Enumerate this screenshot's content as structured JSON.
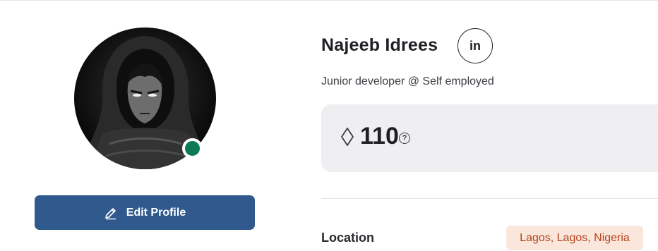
{
  "profile": {
    "name": "Najeeb Idrees",
    "headline": "Junior developer @ Self employed",
    "online_status_color": "#0b7a55",
    "linkedin_label": "in"
  },
  "actions": {
    "edit_profile_label": "Edit Profile",
    "edit_icon": "pencil-icon"
  },
  "points": {
    "value": "110",
    "icon": "diamond-icon",
    "help_label": "?"
  },
  "details": {
    "location_label": "Location",
    "location_value": "Lagos, Lagos, Nigeria"
  },
  "colors": {
    "primary_button": "#305a8e",
    "points_card_bg": "#efeff2",
    "location_badge_bg": "#fbe6dc",
    "location_badge_text": "#b4431c"
  }
}
